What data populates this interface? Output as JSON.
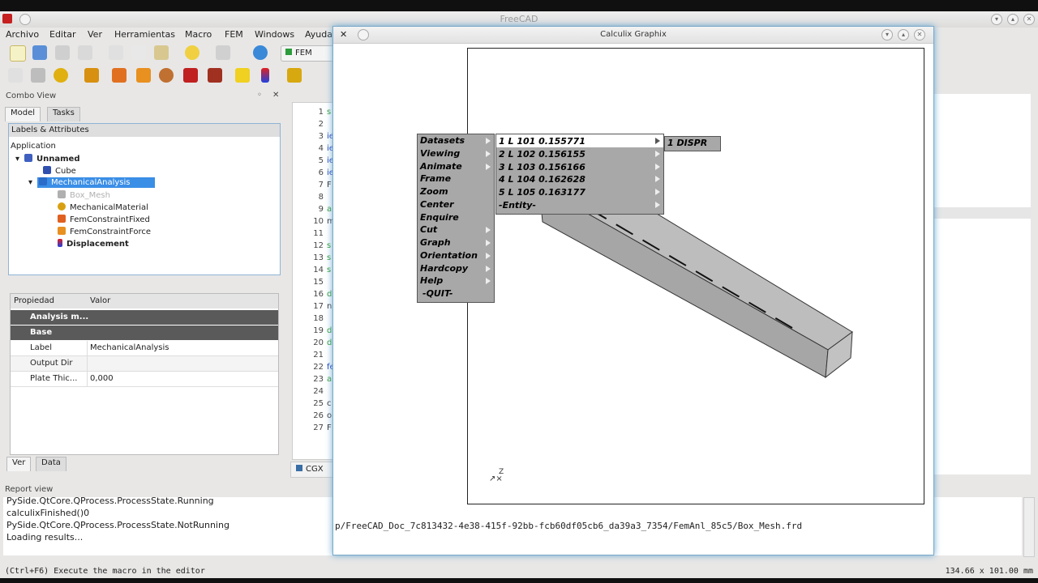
{
  "app": {
    "title": "FreeCAD",
    "menu": [
      "Archivo",
      "Editar",
      "Ver",
      "Herramientas",
      "Macro",
      "FEM",
      "Windows",
      "Ayuda"
    ],
    "workbench": "FEM"
  },
  "combo_view": {
    "title": "Combo View",
    "tabs": [
      "Model",
      "Tasks"
    ],
    "labels_title": "Labels & Attributes",
    "root": "Application",
    "tree": [
      {
        "label": "Unnamed",
        "icon": "document-icon",
        "color": "#4060c0"
      },
      {
        "label": "Cube",
        "icon": "cube-icon",
        "color": "#3050b0"
      },
      {
        "label": "MechanicalAnalysis",
        "icon": "analysis-icon",
        "color": "#2a6cc8",
        "selected": true
      },
      {
        "label": "Box_Mesh",
        "icon": "mesh-icon",
        "color": "#b0b0b0"
      },
      {
        "label": "MechanicalMaterial",
        "icon": "material-icon",
        "color": "#d8a010"
      },
      {
        "label": "FemConstraintFixed",
        "icon": "constraint-fixed-icon",
        "color": "#e06020"
      },
      {
        "label": "FemConstraintForce",
        "icon": "constraint-force-icon",
        "color": "#e06020"
      },
      {
        "label": "Displacement",
        "icon": "result-icon",
        "color": "#202080"
      }
    ],
    "props_header": {
      "prop": "Propiedad",
      "value": "Valor"
    },
    "props_groups": [
      "Analysis m...",
      "Base"
    ],
    "props": [
      {
        "name": "Label",
        "value": "MechanicalAnalysis"
      },
      {
        "name": "Output Dir",
        "value": ""
      },
      {
        "name": "Plate Thic...",
        "value": "0,000"
      }
    ],
    "bottom_tabs": [
      "Ver",
      "Data"
    ]
  },
  "editor": {
    "line_numbers": [
      "1",
      "2",
      "3",
      "4",
      "5",
      "6",
      "7",
      "8",
      "9",
      "10",
      "11",
      "12",
      "13",
      "14",
      "15",
      "16",
      "17",
      "18",
      "19",
      "20",
      "21",
      "22",
      "23",
      "24",
      "25",
      "26",
      "27"
    ],
    "fragments": [
      "s",
      "",
      "ie",
      "ie",
      "ie",
      "ie",
      "F",
      "",
      "a",
      "m",
      "",
      "s",
      "s",
      "s",
      "",
      "d",
      "n",
      "",
      "d",
      "d",
      "",
      "fe",
      "a",
      "",
      "c",
      "o",
      "F"
    ],
    "tab_label": "CGX"
  },
  "report": {
    "title": "Report view",
    "lines": [
      "PySide.QtCore.QProcess.ProcessState.Running",
      "calculixFinished()0",
      "PySide.QtCore.QProcess.ProcessState.NotRunning",
      "Loading results..."
    ]
  },
  "status": {
    "message": "(Ctrl+F6) Execute the macro in the editor",
    "dimensions": "134.66 x 101.00 mm"
  },
  "cgx": {
    "title": "Calculix Graphix",
    "main_menu": [
      "Datasets",
      "Viewing",
      "Animate",
      "Frame",
      "Zoom",
      "Center",
      "Enquire",
      "Cut",
      "Graph",
      "Orientation",
      "Hardcopy",
      "Help",
      "-QUIT-"
    ],
    "main_menu_arrows": [
      true,
      true,
      true,
      false,
      false,
      false,
      false,
      true,
      true,
      true,
      true,
      true,
      false
    ],
    "datasets_menu": [
      "1 L   101 0.155771",
      "2 L   102 0.156155",
      "3 L   103 0.156166",
      "4 L   104 0.162628",
      "5 L   105 0.163177",
      "-Entity-"
    ],
    "entity_menu": [
      "1 DISPR"
    ],
    "axis_label": "Z",
    "path": "p/FreeCAD_Doc_7c813432-4e38-415f-92bb-fcb60df05cb6_da39a3_7354/FemAnl_85c5/Box_Mesh.frd"
  },
  "colors": {
    "selection": "#3a8ee6",
    "menu_bg": "#a8a8a8",
    "beam_fill": "#a6a6a6"
  }
}
